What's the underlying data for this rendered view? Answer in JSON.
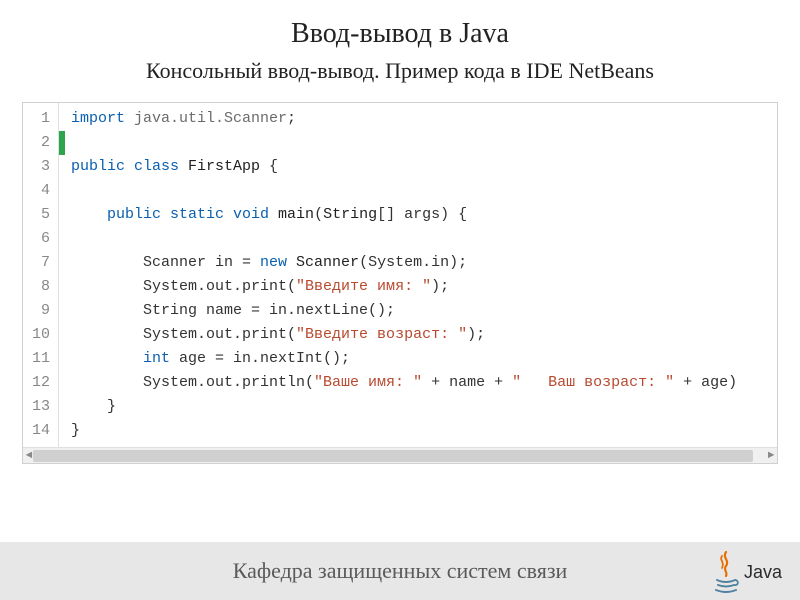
{
  "title": "Ввод-вывод в Java",
  "subtitle": "Консольный ввод-вывод. Пример кода в IDE NetBeans",
  "footer": "Кафедра защищенных систем связи",
  "logo_word": "Java",
  "code": {
    "line_count": 14,
    "green_marker_line": 2,
    "lines": [
      {
        "n": 1,
        "tokens": [
          {
            "t": "import ",
            "c": "tok-kw"
          },
          {
            "t": "java.util.Scanner",
            "c": "tok-pkg"
          },
          {
            "t": ";",
            "c": "tok-plain"
          }
        ]
      },
      {
        "n": 2,
        "tokens": []
      },
      {
        "n": 3,
        "tokens": [
          {
            "t": "public class ",
            "c": "tok-kw"
          },
          {
            "t": "FirstApp ",
            "c": "tok-id"
          },
          {
            "t": "{",
            "c": "tok-plain"
          }
        ]
      },
      {
        "n": 4,
        "tokens": []
      },
      {
        "n": 5,
        "tokens": [
          {
            "t": "    ",
            "c": "tok-plain"
          },
          {
            "t": "public static void ",
            "c": "tok-kw"
          },
          {
            "t": "main",
            "c": "tok-id"
          },
          {
            "t": "(",
            "c": "tok-plain"
          },
          {
            "t": "String",
            "c": "tok-id"
          },
          {
            "t": "[] args) {",
            "c": "tok-plain"
          }
        ]
      },
      {
        "n": 6,
        "tokens": []
      },
      {
        "n": 7,
        "tokens": [
          {
            "t": "        Scanner in = ",
            "c": "tok-plain"
          },
          {
            "t": "new ",
            "c": "tok-kw"
          },
          {
            "t": "Scanner",
            "c": "tok-id"
          },
          {
            "t": "(System.in);",
            "c": "tok-plain"
          }
        ]
      },
      {
        "n": 8,
        "tokens": [
          {
            "t": "        System.out.print(",
            "c": "tok-plain"
          },
          {
            "t": "\"Введите имя: \"",
            "c": "tok-str"
          },
          {
            "t": ");",
            "c": "tok-plain"
          }
        ]
      },
      {
        "n": 9,
        "tokens": [
          {
            "t": "        String name = in.nextLine();",
            "c": "tok-plain"
          }
        ]
      },
      {
        "n": 10,
        "tokens": [
          {
            "t": "        System.out.print(",
            "c": "tok-plain"
          },
          {
            "t": "\"Введите возраст: \"",
            "c": "tok-str"
          },
          {
            "t": ");",
            "c": "tok-plain"
          }
        ]
      },
      {
        "n": 11,
        "tokens": [
          {
            "t": "        ",
            "c": "tok-plain"
          },
          {
            "t": "int ",
            "c": "tok-kw"
          },
          {
            "t": "age = in.nextInt();",
            "c": "tok-plain"
          }
        ]
      },
      {
        "n": 12,
        "tokens": [
          {
            "t": "        System.out.println(",
            "c": "tok-plain"
          },
          {
            "t": "\"Ваше имя: \"",
            "c": "tok-str"
          },
          {
            "t": " + name + ",
            "c": "tok-plain"
          },
          {
            "t": "\"   Ваш возраст: \"",
            "c": "tok-str"
          },
          {
            "t": " + age)",
            "c": "tok-plain"
          }
        ]
      },
      {
        "n": 13,
        "tokens": [
          {
            "t": "    }",
            "c": "tok-plain"
          }
        ]
      },
      {
        "n": 14,
        "tokens": [
          {
            "t": "}",
            "c": "tok-plain"
          }
        ]
      }
    ]
  }
}
